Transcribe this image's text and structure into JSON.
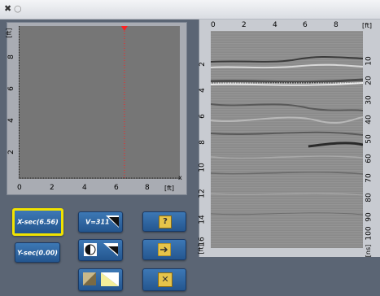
{
  "window": {
    "close_glyph": "✖",
    "minimize_glyph": "○"
  },
  "profile_plot": {
    "x_ticks": [
      "0",
      "2",
      "4",
      "6",
      "8"
    ],
    "y_ticks": [
      "2",
      "4",
      "6",
      "8"
    ],
    "unit": "[ft]",
    "cursor_label": "x",
    "cursor_x": 6.56,
    "cursor_color": "#ff2020"
  },
  "radargram": {
    "top_ticks": [
      "0",
      "2",
      "4",
      "6",
      "8"
    ],
    "top_unit": "[ft]",
    "left_ticks": [
      "2",
      "4",
      "6",
      "8",
      "10",
      "12",
      "14",
      "16"
    ],
    "left_unit": "[ft]",
    "right_ticks": [
      "10",
      "20",
      "30",
      "40",
      "50",
      "60",
      "70",
      "80",
      "90",
      "100"
    ],
    "right_unit": "[ns]"
  },
  "controls": {
    "x_sec_label": "X-sec(6.56)",
    "y_sec_label": "Y-sec(0.00)",
    "velocity_label": "V=311",
    "help_glyph": "?",
    "close_glyph": "✕",
    "selected_color": "#f1e300"
  }
}
